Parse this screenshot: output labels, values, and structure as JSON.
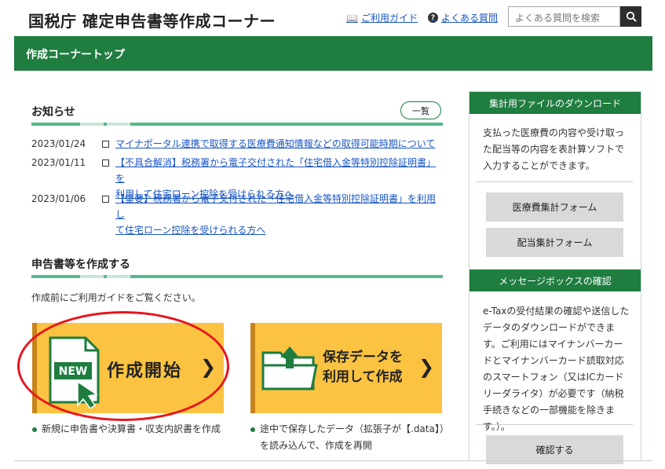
{
  "header": {
    "site_title": "国税庁 確定申告書等作成コーナー",
    "guide_link": "ご利用ガイド",
    "faq_link": "よくある質問",
    "search_placeholder": "よくある質問を検索"
  },
  "nav": {
    "breadcrumb": "作成コーナートップ"
  },
  "news": {
    "title": "お知らせ",
    "list_button": "一覧",
    "items": [
      {
        "date": "2023/01/24",
        "line1": "マイナポータル連携で取得する医療費通知情報などの取得可能時期について",
        "line2": ""
      },
      {
        "date": "2023/01/11",
        "line1": "【不具合解消】税務署から電子交付された「住宅借入金等特別控除証明書」を",
        "line2": "利用して住宅ローン控除を受けられる方へ"
      },
      {
        "date": "2023/01/06",
        "line1": "【重要】税務署から電子交付された「住宅借入金等特別控除証明書」を利用し",
        "line2": "て住宅ローン控除を受けられる方へ"
      }
    ]
  },
  "create": {
    "title": "申告書等を作成する",
    "note": "作成前にご利用ガイドをご覧ください。",
    "start_card": {
      "badge": "NEW",
      "label": "作成開始"
    },
    "saved_card": {
      "label_line1": "保存データを",
      "label_line2": "利用して作成"
    },
    "start_note": "新規に申告書や決算書・収支内訳書を作成",
    "saved_note_line1": "途中で保存したデータ（拡張子が【.data】）",
    "saved_note_line2": "を読み込んで、作成を再開"
  },
  "sidebar": {
    "download": {
      "header": "集計用ファイルのダウンロード",
      "text": "支払った医療費の内容や受け取った配当等の内容を表計算ソフトで入力することができます。",
      "btn_medical": "医療費集計フォーム",
      "btn_dividend": "配当集計フォーム"
    },
    "message": {
      "header": "メッセージボックスの確認",
      "text": "e-Taxの受付結果の確認や送信したデータのダウンロードができます。ご利用にはマイナンバーカードとマイナンバーカード読取対応のスマートフォン（又はICカードリーダライタ）が必要です（納税手続きなどの一部機能を除きます。）。",
      "btn_confirm": "確認する"
    }
  },
  "colors": {
    "brand_green": "#1e7d3f",
    "card_yellow": "#fbc341",
    "link_blue": "#1a56c4",
    "highlight_red": "#e8141c"
  }
}
